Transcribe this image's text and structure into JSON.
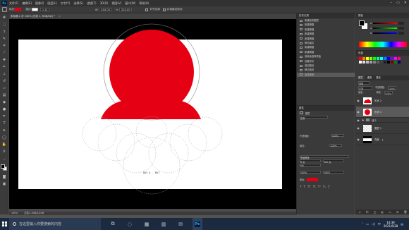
{
  "menubar": {
    "logo": "Ps",
    "items": [
      "文件(F)",
      "编辑(E)",
      "图像(I)",
      "图层(L)",
      "文字(Y)",
      "选择(S)",
      "滤镜(T)",
      "3D(D)",
      "视图(V)",
      "窗口(W)",
      "帮助(H)"
    ]
  },
  "optbar": {
    "fill_label": "填充:",
    "stroke_label": "描边:",
    "stroke_size": "1 点",
    "w_label": "W:",
    "w_value": "404.00",
    "h_label": "H:",
    "h_value": "324.00",
    "align_label": "对齐边缘",
    "constrain_label": "约束路径拖动",
    "fill_color": "#e60013"
  },
  "doctab": {
    "title": "未标题-1 @ 100% (形状 1, RGB/8#) *"
  },
  "canvas": {
    "sample_text": "DAY 4 _ RAT",
    "shape_color": "#e60013"
  },
  "statusbar": {
    "zoom": "100%",
    "doc_info": "文档:1.40M/2.83M"
  },
  "history": {
    "tab": "历史记录",
    "items": [
      {
        "label": "新建矩形图层",
        "selected": false
      },
      {
        "label": "新建椭圆",
        "selected": false
      },
      {
        "label": "新建椭圆",
        "selected": false
      },
      {
        "label": "新建椭圆",
        "selected": false
      },
      {
        "label": "新建椭圆",
        "selected": false
      },
      {
        "label": "移动锚点",
        "selected": false
      },
      {
        "label": "新建椭圆",
        "selected": false
      },
      {
        "label": "新建椭圆",
        "selected": false
      },
      {
        "label": "用像素选择蒙板",
        "selected": false
      },
      {
        "label": "设置形状",
        "selected": false
      },
      {
        "label": "增加路径",
        "selected": false
      },
      {
        "label": "移动选择",
        "selected": false
      },
      {
        "label": "合并形状",
        "selected": true
      }
    ]
  },
  "properties": {
    "tab": "属性",
    "kind": "图层",
    "mode_label": "正常",
    "opacity_label": "不透明度:",
    "opacity_value": "100%",
    "fill_label": "填充:",
    "fill_value": "100%",
    "stroke_label": "描边",
    "font_label": "思源黑体",
    "size_a": "6 点",
    "size_b": "100 点",
    "width_pct": "0%",
    "scale_a": "100%",
    "scale_b": "100%",
    "color_label": "颜色:"
  },
  "color": {
    "tab": "颜色",
    "r_label": "R",
    "g_label": "G",
    "b_label": "B"
  },
  "swatches": {
    "tab": "色板"
  },
  "layers": {
    "tabs": [
      "图层",
      "通道",
      "路径"
    ],
    "kind_label": "类型",
    "blend_label": "正常",
    "opacity_label": "不透明度:",
    "opacity_value": "100%",
    "lock_label": "锁定:",
    "fill_label": "填充:",
    "fill_value": "100%",
    "items": [
      {
        "name": "形状 2",
        "selected": false,
        "group": false
      },
      {
        "name": "形状 1",
        "selected": true,
        "group": false
      },
      {
        "name": "组 1",
        "selected": false,
        "group": true
      },
      {
        "name": "图层 1",
        "selected": false,
        "group": false
      },
      {
        "name": "背景",
        "selected": false,
        "group": false
      }
    ]
  },
  "taskbar": {
    "search_placeholder": "在这里输入你要搜索的内容",
    "time": "14:39",
    "date": "2021/6/28",
    "lang": "中"
  }
}
